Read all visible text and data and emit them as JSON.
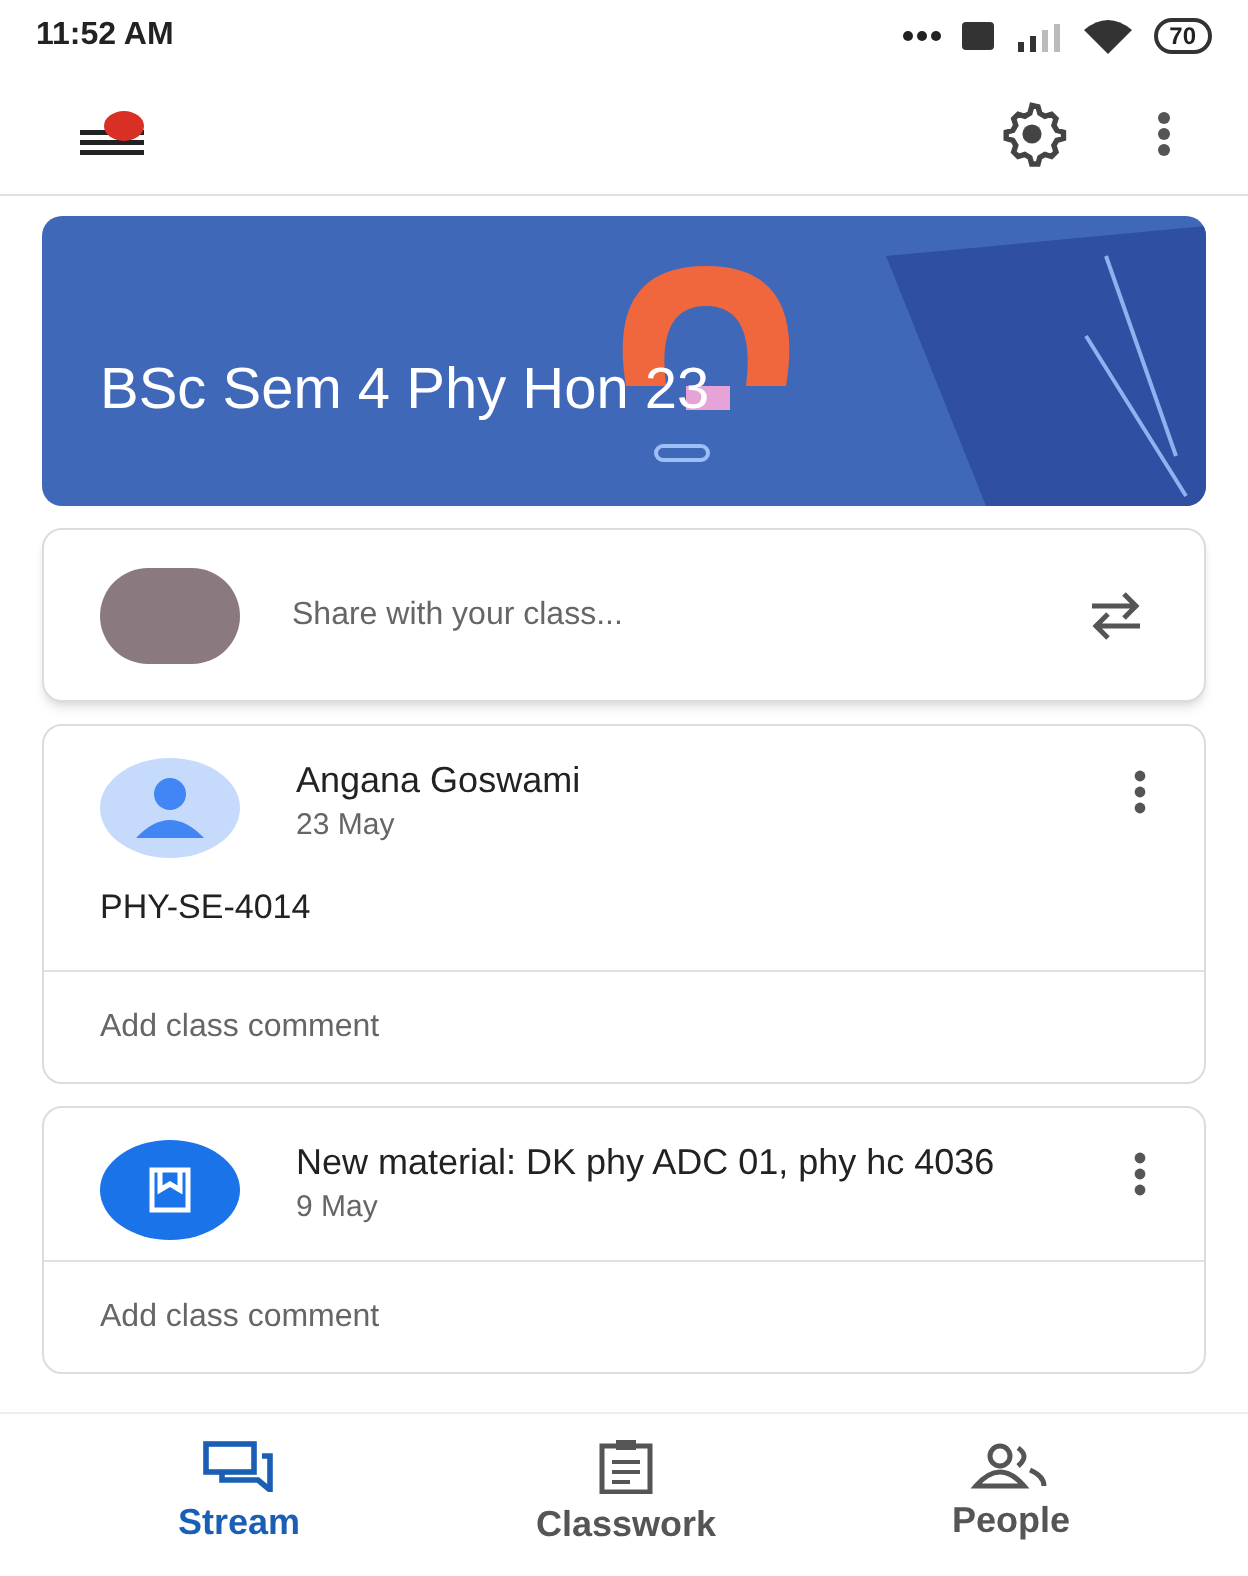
{
  "status_bar": {
    "time": "11:52 AM",
    "battery": "70"
  },
  "header": {
    "notification_dot": true
  },
  "banner": {
    "title": "BSc Sem 4 Phy Hon 23"
  },
  "share": {
    "placeholder": "Share with your class..."
  },
  "posts": [
    {
      "kind": "announcement",
      "author_or_title": "Angana Goswami",
      "date": "23 May",
      "body": "PHY-SE-4014",
      "comment_placeholder": "Add class comment"
    },
    {
      "kind": "material",
      "author_or_title": "New material: DK phy ADC 01, phy hc 4036",
      "date": "9 May",
      "comment_placeholder": "Add class comment"
    }
  ],
  "tabs": [
    {
      "kind": "stream",
      "label": "Stream",
      "selected": true
    },
    {
      "kind": "classwork",
      "label": "Classwork",
      "selected": false
    },
    {
      "kind": "people",
      "label": "People",
      "selected": false
    }
  ]
}
